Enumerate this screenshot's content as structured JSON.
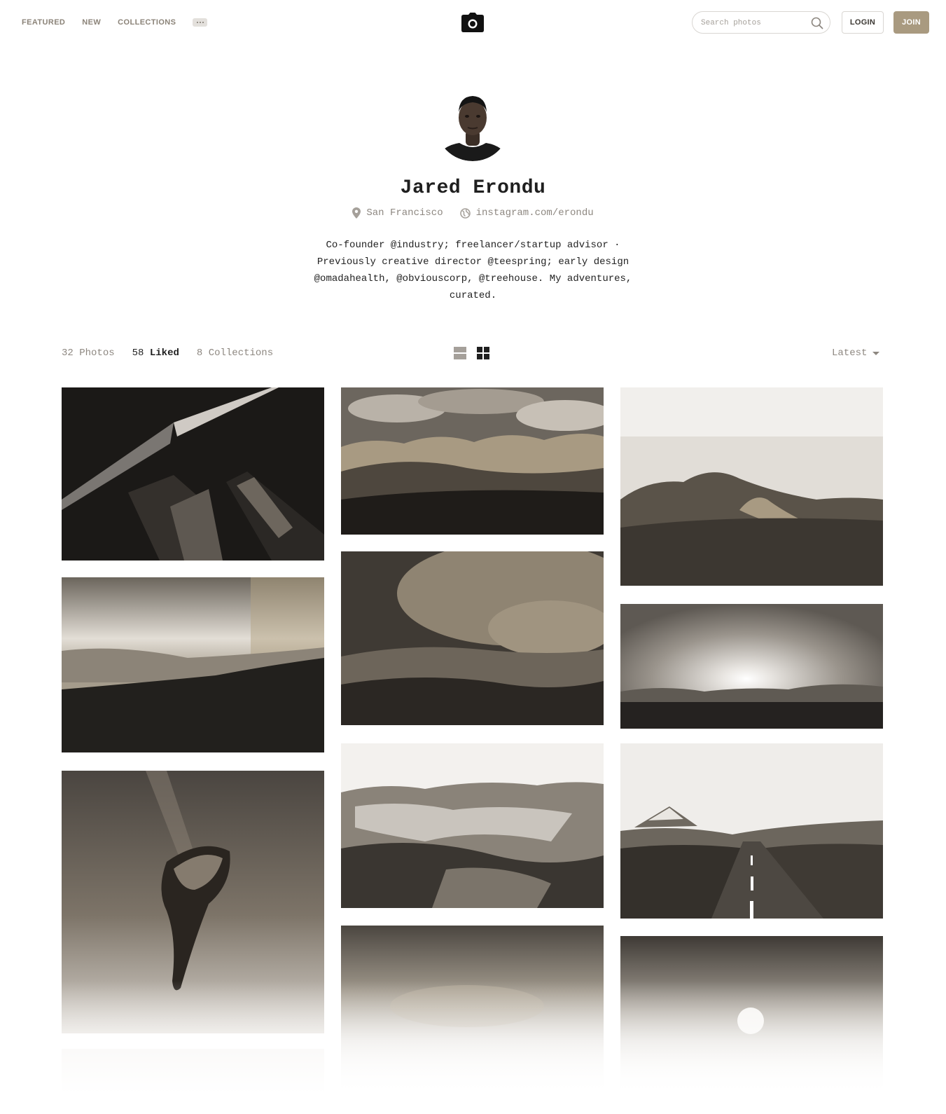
{
  "nav": {
    "items": [
      {
        "label": "FEATURED"
      },
      {
        "label": "NEW"
      },
      {
        "label": "COLLECTIONS"
      }
    ],
    "more_icon": "ellipsis-icon"
  },
  "logo_icon": "camera-icon",
  "search": {
    "placeholder": "Search photos",
    "value": "",
    "icon": "search-icon"
  },
  "auth": {
    "login_label": "LOGIN",
    "join_label": "JOIN"
  },
  "colors": {
    "accent": "#a99a80",
    "muted_text": "#8d8780",
    "text": "#1f1f1f"
  },
  "profile": {
    "name": "Jared Erondu",
    "location": "San Francisco",
    "location_icon": "map-pin-icon",
    "website": "instagram.com/erondu",
    "website_icon": "globe-icon",
    "bio": "Co-founder @industry; freelancer/startup advisor · Previously creative director @teespring; early design @omadahealth, @obviouscorp, @treehouse. My adventures, curated."
  },
  "stats": {
    "photos": {
      "count": "32",
      "label": "Photos"
    },
    "liked": {
      "count": "58",
      "label": "Liked"
    },
    "collections": {
      "count": "8",
      "label": "Collections"
    }
  },
  "view_toggle": {
    "list_icon": "list-view-icon",
    "grid_icon": "grid-view-icon",
    "active": "grid"
  },
  "sort": {
    "label": "Latest",
    "icon": "chevron-down-icon"
  },
  "photos": [
    {
      "subject": "skyscraper-looking-up"
    },
    {
      "subject": "cloudy-mountain-valley"
    },
    {
      "subject": "green-hills-road"
    },
    {
      "subject": "misty-hillside"
    },
    {
      "subject": "stormy-landscape"
    },
    {
      "subject": "sunset-horizon"
    },
    {
      "subject": "underwater-swimmer"
    },
    {
      "subject": "glacier"
    },
    {
      "subject": "mountain-road"
    },
    {
      "subject": "foggy-landscape"
    },
    {
      "subject": "moon-horizon"
    },
    {
      "subject": "faded-photo"
    }
  ]
}
